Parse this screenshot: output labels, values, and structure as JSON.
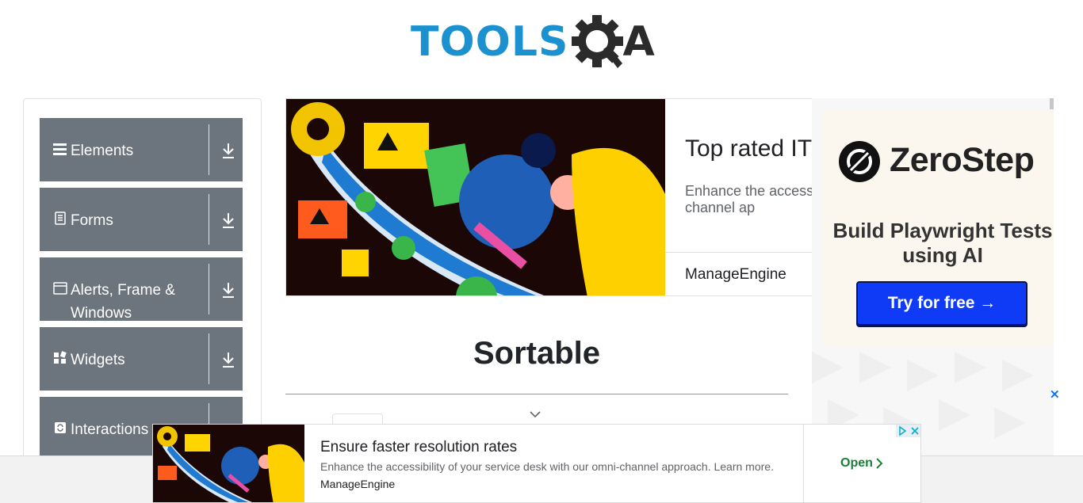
{
  "header": {
    "logo_text": "TOOLS",
    "logo_suffix": "A"
  },
  "sidebar": {
    "groups": [
      {
        "label": "Elements",
        "icon": "hamburger-icon"
      },
      {
        "label": "Forms",
        "icon": "document-icon"
      },
      {
        "label": "Alerts, Frame & Windows",
        "icon": "window-icon"
      },
      {
        "label": "Widgets",
        "icon": "widgets-icon"
      },
      {
        "label": "Interactions",
        "icon": "interactions-icon"
      }
    ]
  },
  "ad_banner": {
    "title": "Top rated IT",
    "description": "Enhance the access our omni-channel ap",
    "brand": "ManageEngine"
  },
  "right_ad": {
    "brand": "ZeroStep",
    "tagline": "Build Playwright Tests using AI",
    "cta": "Try for free →",
    "close_glyph": "✕"
  },
  "main": {
    "heading": "Sortable"
  },
  "bottom_ad": {
    "title": "Ensure faster resolution rates",
    "description": "Enhance the accessibility of your service desk with our omni-channel approach. Learn more.",
    "brand": "ManageEngine",
    "open_label": "Open"
  },
  "colors": {
    "brand_blue": "#1b91cf",
    "sidebar_gray": "#6c757d",
    "cta_blue": "#0f3bf6",
    "open_green": "#188038"
  }
}
